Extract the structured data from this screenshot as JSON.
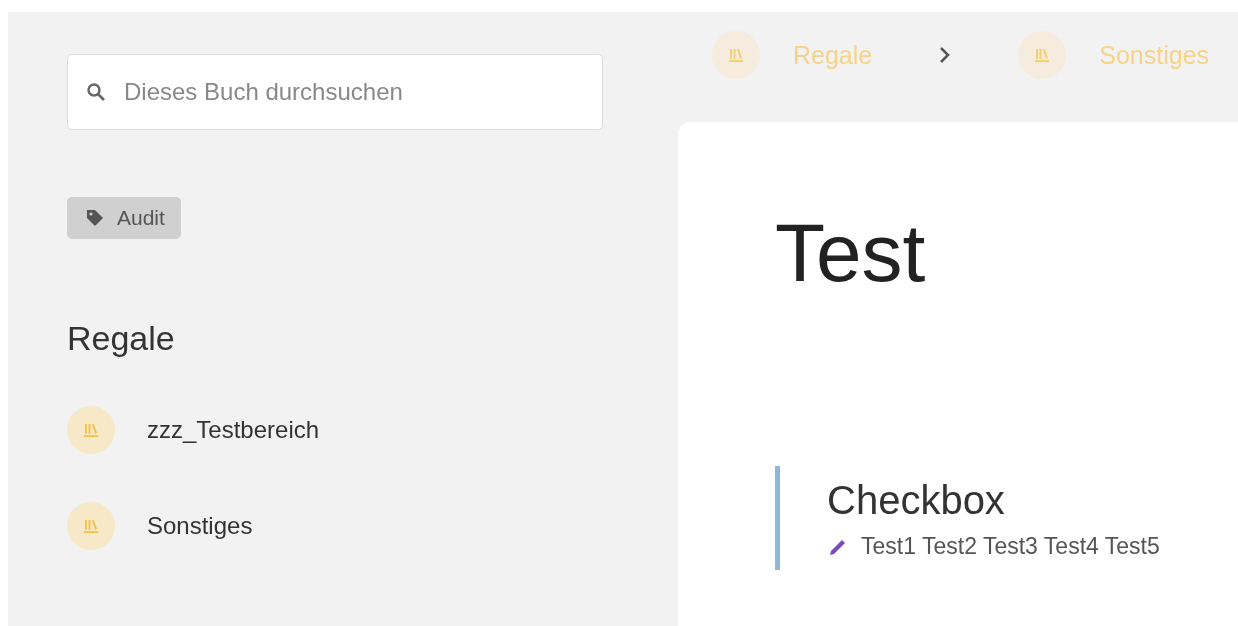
{
  "sidebar": {
    "search": {
      "placeholder": "Dieses Buch durchsuchen"
    },
    "tags": [
      {
        "label": "Audit"
      }
    ],
    "shelves_heading": "Regale",
    "shelves": [
      {
        "label": "zzz_Testbereich"
      },
      {
        "label": "Sonstiges"
      }
    ]
  },
  "breadcrumbs": [
    {
      "label": "Regale"
    },
    {
      "label": "Sonstiges"
    }
  ],
  "page": {
    "title": "Test",
    "pages": [
      {
        "title": "Checkbox",
        "preview": "Test1 Test2 Test3 Test4 Test5"
      }
    ]
  }
}
